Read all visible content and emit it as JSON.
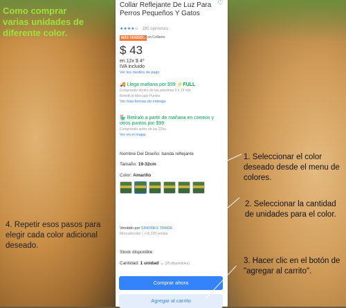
{
  "caption": [
    "Como comprar",
    "varias unidades de",
    "diferente color."
  ],
  "annotations": {
    "step1": "1. Seleccionar el color deseado desde el menu de colores.",
    "step2": "2. Seleccionar la cantidad de unidades para el color.",
    "step3": "3. Hacer clic en el botón de \"agregar al carrito\".",
    "step4": "4. Repetir esos pasos para elegir cada color adicional deseado."
  },
  "product": {
    "title": "Collar Reflejante De Luz Para Perros Pequeños Y Gatos",
    "rating_stars": "★★★★☆",
    "rating_count": "180 opiniones",
    "badge": "MÁS VENDIDO",
    "badge_sub": "2° en Collares",
    "price": "$ 43",
    "cuotas": "en 12x $ 4⁰",
    "iva": "IVA incluido",
    "payment_link": "Ver los medios de pago",
    "shipping_title": "Llega mañana por $99",
    "full_label": "⚡FULL",
    "shipping_detail": "Comprando dentro de las próximas 9 h 16 min",
    "shipping_benefit": "Beneficio Mercado Puntos",
    "shipping_more": "Ver más formas de entrega",
    "pickup_title": "Retiralo a partir de mañana en correos y otros puntos por $99",
    "pickup_detail": "Comprando antes de las 22hs.",
    "pickup_map": "Ver en el mapa",
    "design_label": "Nombre Del Diseño:",
    "design_value": "banda reflejante",
    "size_label": "Tamaño:",
    "size_value": "19-32cm",
    "color_label": "Color:",
    "color_value": "Amarillo",
    "seller_label": "Vendido por",
    "seller_name": "SINOMEX TRADE",
    "seller_meta": "MercadoLíder | +10,335 ventas",
    "stock": "Stock disponible",
    "qty_label": "Cantidad:",
    "qty_value": "1 unidad",
    "qty_available": "(25 disponibles)",
    "buy_button": "Comprar ahora",
    "cart_button": "Agregar al carrito"
  },
  "colors": {
    "accent": "#3483fa",
    "green": "#00a650",
    "caption": "#9fe23b"
  }
}
